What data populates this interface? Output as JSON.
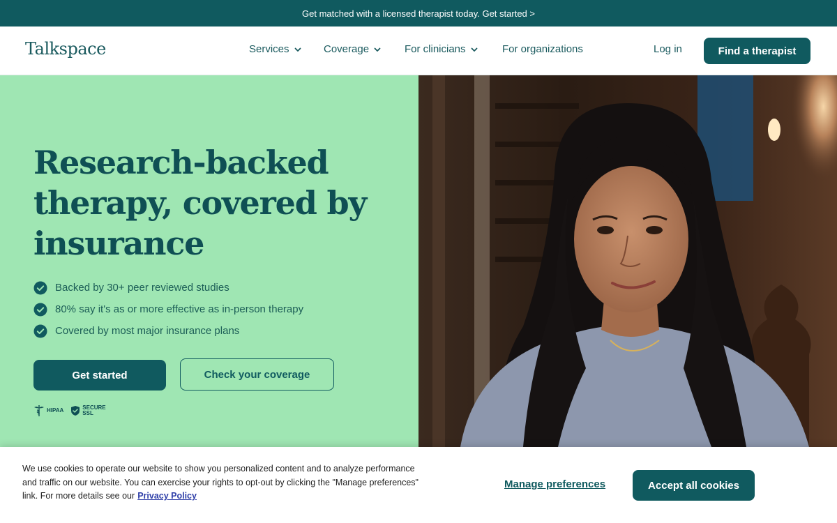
{
  "promo": {
    "text": "Get matched with a licensed therapist today. Get started >"
  },
  "nav": {
    "logo": "Talkspace",
    "items": [
      {
        "label": "Services",
        "has_dropdown": true
      },
      {
        "label": "Coverage",
        "has_dropdown": true
      },
      {
        "label": "For clinicians",
        "has_dropdown": true
      },
      {
        "label": "For organizations",
        "has_dropdown": false
      }
    ],
    "login": "Log in",
    "cta": "Find a therapist"
  },
  "hero": {
    "headline": "Research-backed therapy, covered by insurance",
    "bullets": [
      "Backed by 30+ peer reviewed studies",
      "80% say it's as or more effective as in-person therapy",
      "Covered by most major insurance plans"
    ],
    "primary_cta": "Get started",
    "secondary_cta": "Check your coverage",
    "badges": {
      "hipaa": "HIPAA",
      "ssl_line1": "SECURE",
      "ssl_line2": "SSL"
    }
  },
  "cookie": {
    "text": "We use cookies to operate our website to show you personalized content and to analyze performance and traffic on our website. You can exercise your rights to opt-out by clicking the \"Manage preferences\" link. For more details see our",
    "privacy_link": "Privacy Policy",
    "manage": "Manage preferences",
    "accept": "Accept all cookies"
  },
  "colors": {
    "brand_teal": "#105a5f",
    "hero_green": "#9fe6b3",
    "link_blue": "#2f3fa8"
  },
  "icons": [
    "chevron-down-icon",
    "check-circle-icon",
    "hipaa-caduceus-icon",
    "shield-check-icon"
  ]
}
